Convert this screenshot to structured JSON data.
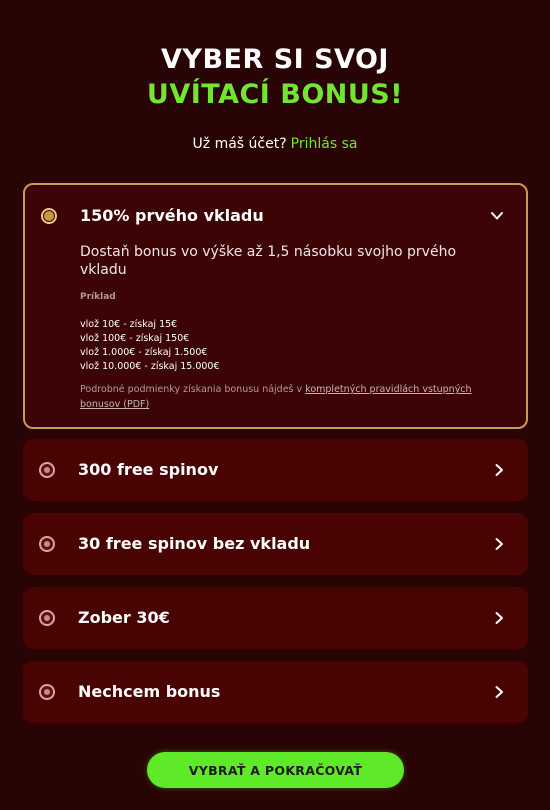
{
  "header": {
    "title_line1": "VYBER SI SVOJ",
    "title_line2": "UVÍTACÍ BONUS!"
  },
  "login": {
    "prompt": "Už máš účet?",
    "link": "Prihlás sa"
  },
  "bonuses": [
    {
      "title": "150% prvého vkladu",
      "selected": true,
      "expanded": true,
      "description": "Dostaň bonus vo výške až 1,5 násobku svojho prvého vkladu",
      "example_label": "Príklad",
      "examples": [
        "vlož 10€ - získaj 15€",
        "vlož 100€ - získaj 150€",
        "vlož 1.000€ - získaj 1.500€",
        "vlož 10.000€ - získaj 15.000€"
      ],
      "terms_text": "Podrobné podmienky získania bonusu nájdeš v ",
      "terms_link": "kompletných pravidlách vstupných bonusov (PDF)"
    },
    {
      "title": "300 free spinov",
      "selected": false
    },
    {
      "title": "30 free spinov bez vkladu",
      "selected": false
    },
    {
      "title": "Zober 30€",
      "selected": false
    },
    {
      "title": "Nechcem bonus",
      "selected": false
    }
  ],
  "cta": {
    "label": "VYBRAŤ A POKRAČOVAŤ"
  },
  "colors": {
    "background": "#280404",
    "card": "#4a0303",
    "accent_green": "#74e433",
    "border_gold": "#c89a52"
  },
  "icons": {
    "expanded_chevron": "chevron-down-icon",
    "collapsed_chevron": "chevron-right-icon",
    "radio": "radio-icon"
  }
}
